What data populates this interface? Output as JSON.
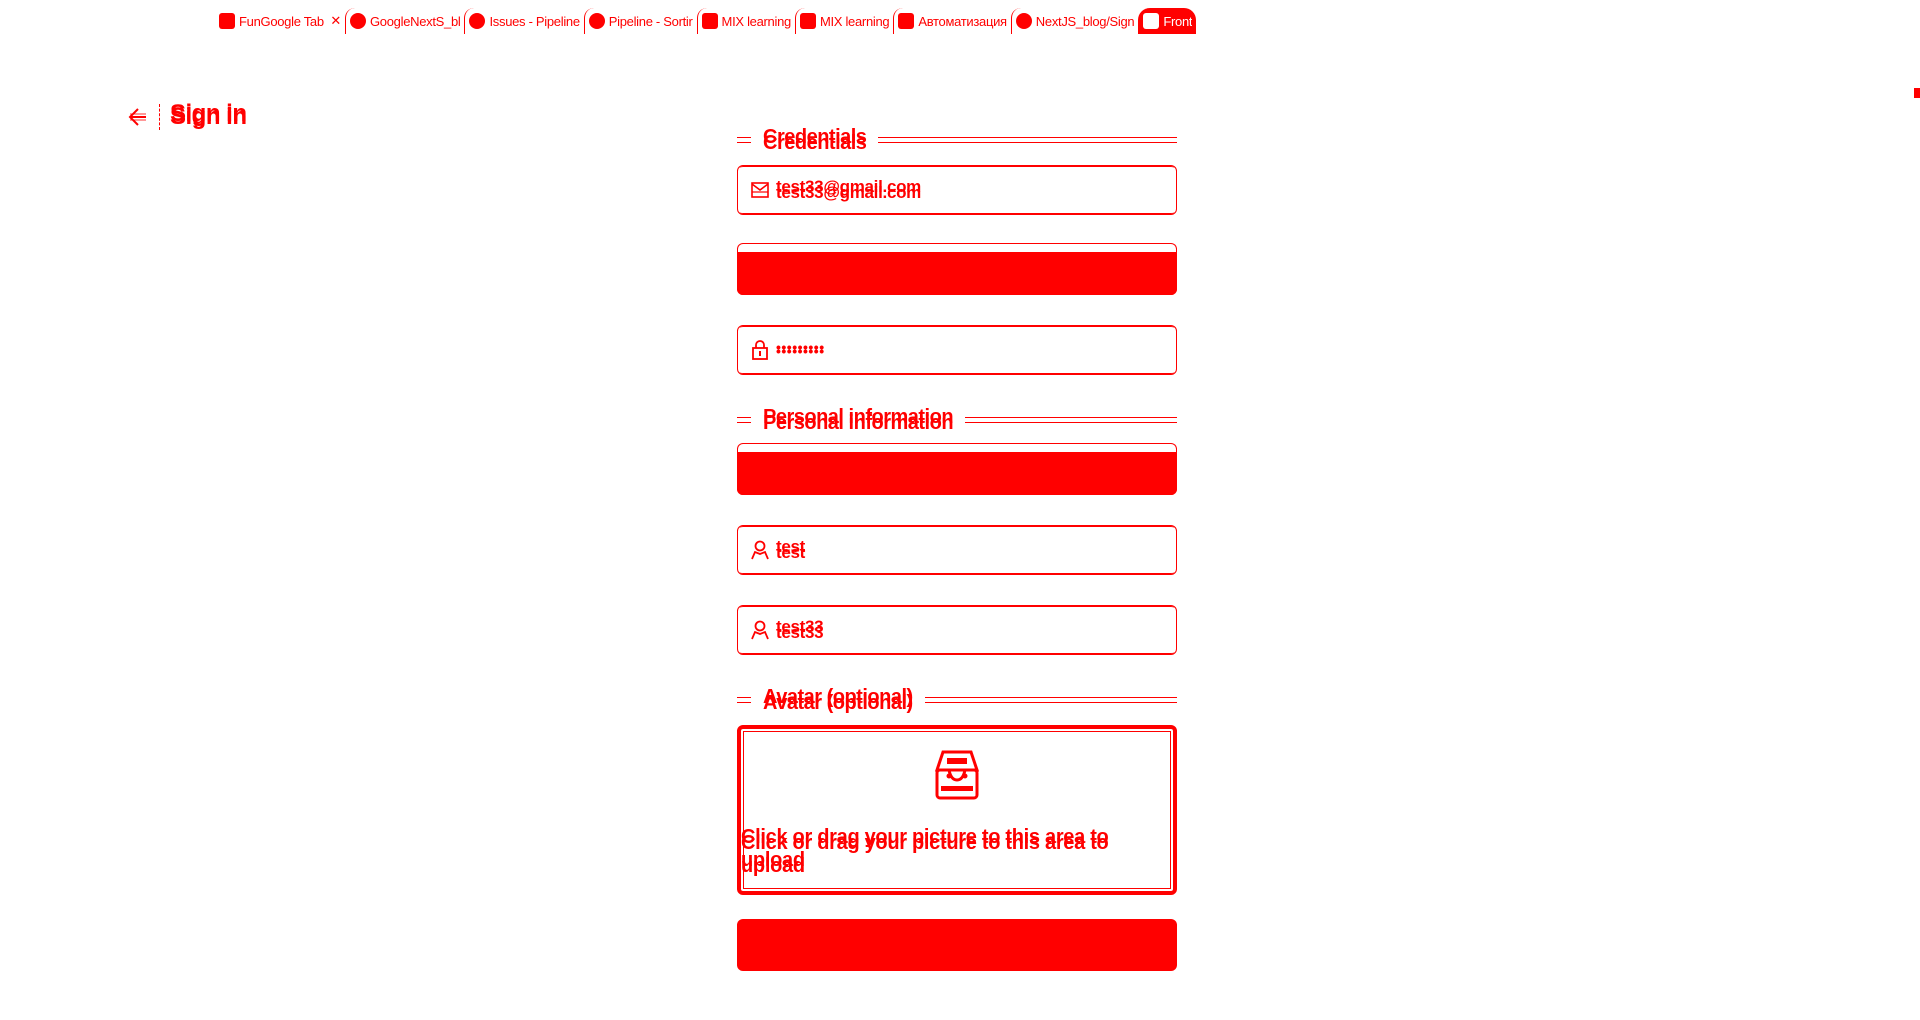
{
  "browser": {
    "tabs": [
      {
        "title": "FunGoogle Tabs",
        "icon": "gmail-icon",
        "active": false
      },
      {
        "title": "GoogleNextS_bl",
        "icon": "github-icon",
        "active": false
      },
      {
        "title": "Issues - Pipeline",
        "icon": "gitlab-icon",
        "active": false
      },
      {
        "title": "Pipeline - Sortir",
        "icon": "gitlab-icon",
        "active": false
      },
      {
        "title": "MIX learning",
        "icon": "doc-icon",
        "active": false
      },
      {
        "title": "MIX learning",
        "icon": "doc-icon",
        "active": false
      },
      {
        "title": "Автоматизация",
        "icon": "doc-icon",
        "active": false
      },
      {
        "title": "NextJS_blog/Sign",
        "icon": "github-icon",
        "active": false
      },
      {
        "title": "Front",
        "icon": "app-icon",
        "active": true
      }
    ]
  },
  "header": {
    "back_icon": "arrow-left-icon",
    "title": "Sign in"
  },
  "form": {
    "credentials_title": "Credentials",
    "email_value": "test33@gmail.com",
    "email_icon": "mail-icon",
    "password_value": "•••••••••",
    "password_icon": "lock-icon",
    "personal_title": "Personal information",
    "first_name_value": "test",
    "last_name_value": "test33",
    "user_icon": "user-icon",
    "avatar_title": "Avatar (optional)",
    "upload_icon": "inbox-icon",
    "upload_text": "Click or drag your picture to this area to upload",
    "submit_label": ""
  },
  "colors": {
    "accent": "#ff0000",
    "background": "#ffffff"
  }
}
